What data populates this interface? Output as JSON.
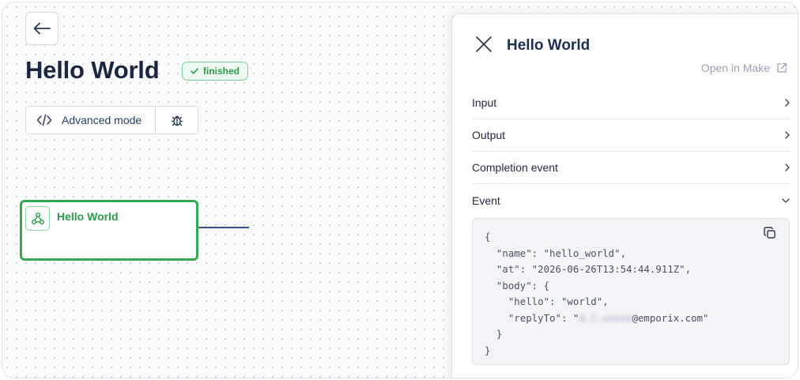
{
  "header": {
    "title": "Hello World",
    "status": "finished"
  },
  "toolbar": {
    "advanced_label": "Advanced mode"
  },
  "node": {
    "title": "Hello World"
  },
  "panel": {
    "title": "Hello World",
    "open_link": "Open in Make",
    "sections": [
      {
        "label": "Input",
        "expanded": false
      },
      {
        "label": "Output",
        "expanded": false
      },
      {
        "label": "Completion event",
        "expanded": false
      },
      {
        "label": "Event",
        "expanded": true
      }
    ],
    "event_code": {
      "line1": "{",
      "line2": "  \"name\": \"hello_world\",",
      "line3": "  \"at\": \"2026-06-26T13:54:44.911Z\",",
      "line4": "  \"body\": {",
      "line5": "    \"hello\": \"world\",",
      "line6_prefix": "    \"replyTo\": \"",
      "line6_blur": "d.l.xxxxx",
      "line6_suffix": "@emporix.com\"",
      "line7": "  }",
      "line8": "}"
    }
  },
  "colors": {
    "success": "#34a853",
    "accent": "#2b3a67",
    "title": "#1b2640"
  },
  "icons": {
    "back": "arrow-left-icon",
    "status": "check-icon",
    "advanced": "code-icon",
    "debug": "bug-icon",
    "node": "webhook-icon",
    "close": "close-icon",
    "external": "external-link-icon",
    "chevron_right": "chevron-right-icon",
    "chevron_down": "chevron-down-icon",
    "copy": "copy-icon"
  }
}
